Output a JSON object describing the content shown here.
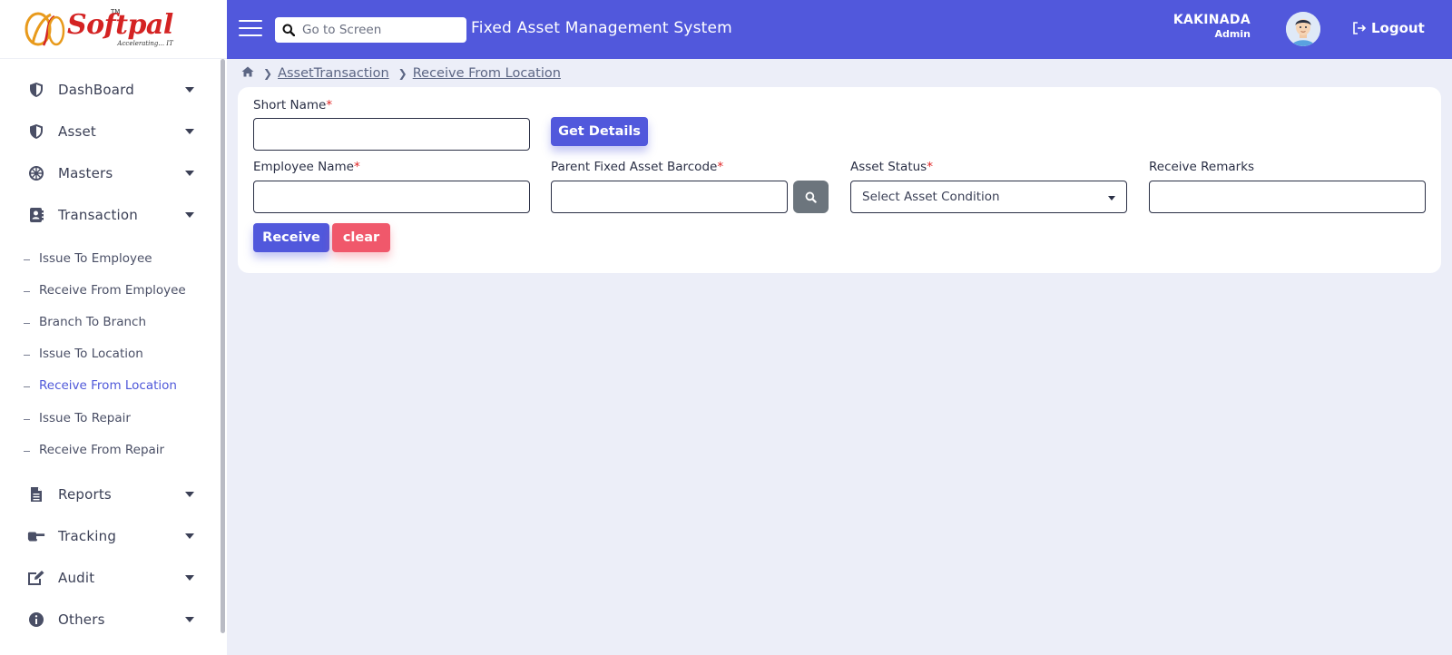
{
  "brand": {
    "logo_text": "Softpal",
    "tagline": "Accelerating... IT",
    "trademark": "TM"
  },
  "header": {
    "search_placeholder": "Go to Screen",
    "title": "Fixed Asset Management System",
    "user_name": "KAKINADA",
    "user_role": "Admin",
    "logout_label": "Logout",
    "color": "#5158dc"
  },
  "sidebar": {
    "items": [
      {
        "label": "DashBoard",
        "icon": "shield-icon"
      },
      {
        "label": "Asset",
        "icon": "shield-icon"
      },
      {
        "label": "Masters",
        "icon": "dharma-wheel-icon"
      },
      {
        "label": "Transaction",
        "icon": "address-book-icon"
      },
      {
        "label": "Reports",
        "icon": "file-icon"
      },
      {
        "label": "Tracking",
        "icon": "tank-icon"
      },
      {
        "label": "Audit",
        "icon": "edit-icon"
      },
      {
        "label": "Others",
        "icon": "info-icon"
      }
    ],
    "transaction_sub": [
      "Issue To Employee",
      "Receive From Employee",
      "Branch To Branch",
      "Issue To Location",
      "Receive From Location",
      "Issue To Repair",
      "Receive From Repair"
    ],
    "active_sub": "Receive From Location"
  },
  "breadcrumb": {
    "items": [
      "AssetTransaction",
      "Receive From Location"
    ]
  },
  "form": {
    "short_name_label": "Short Name",
    "get_details_label": "Get Details",
    "employee_name_label": "Employee Name",
    "parent_barcode_label": "Parent Fixed Asset Barcode",
    "asset_status_label": "Asset Status",
    "asset_status_selected": "Select Asset Condition",
    "receive_remarks_label": "Receive Remarks",
    "required_mark": "*",
    "receive_label": "Receive",
    "clear_label": "clear"
  }
}
